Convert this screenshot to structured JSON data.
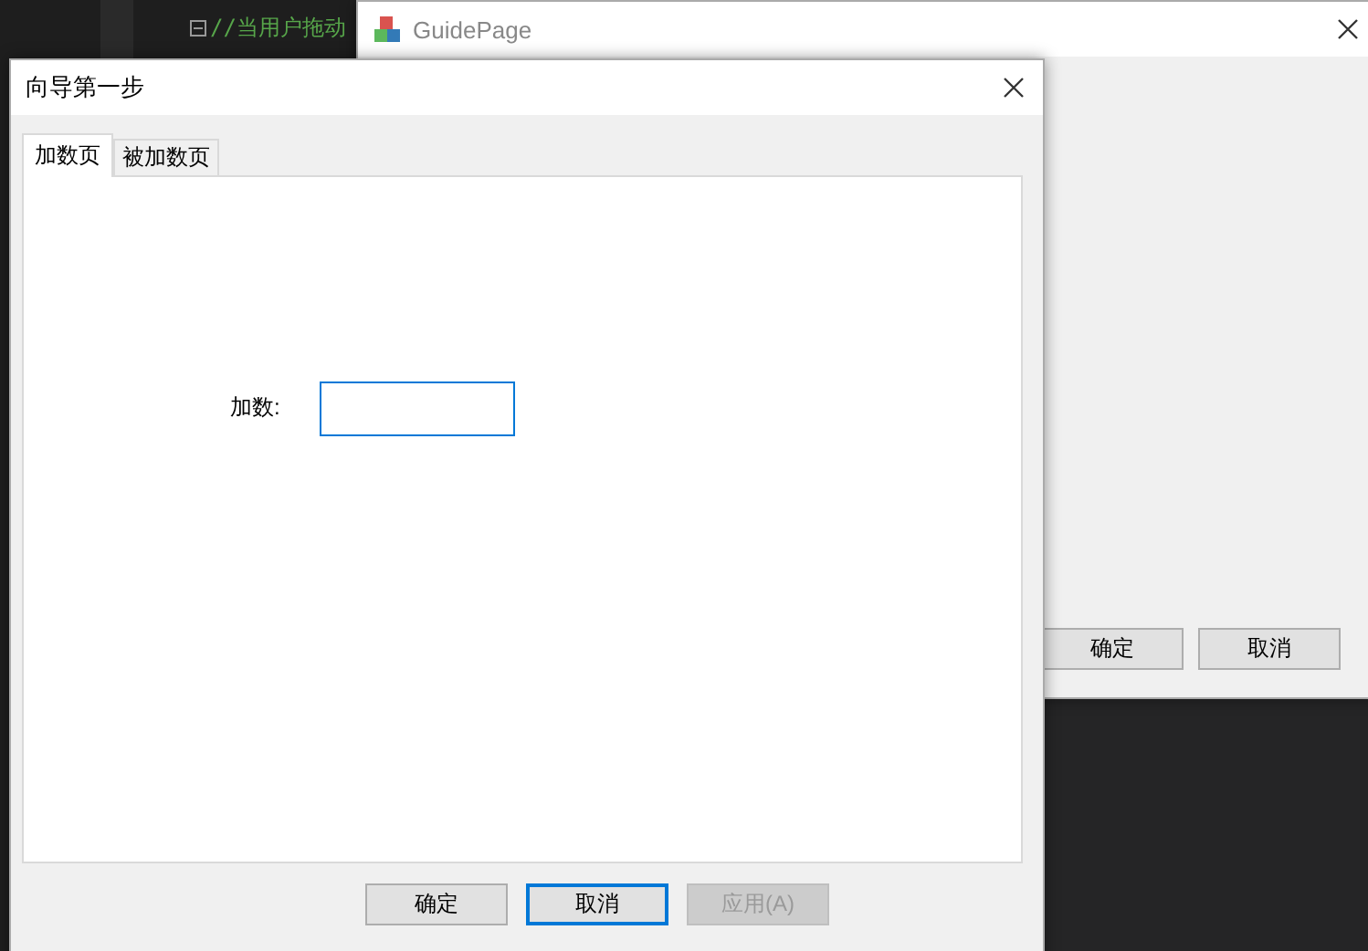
{
  "editor": {
    "lines": [
      {
        "text": "//当用户拖动"
      }
    ]
  },
  "back_window": {
    "title": "GuidePage",
    "buttons": [
      {
        "label": "确定"
      },
      {
        "label": "取消"
      }
    ]
  },
  "dialog": {
    "title": "向导第一步",
    "tabs": [
      {
        "label": "加数页",
        "selected": true
      },
      {
        "label": "被加数页",
        "selected": false
      }
    ],
    "field": {
      "label": "加数:",
      "focused": true
    },
    "buttons": [
      {
        "label": "确定",
        "default": false,
        "disabled": false
      },
      {
        "label": "取消",
        "default": true,
        "disabled": false
      },
      {
        "label": "应用(A)",
        "default": false,
        "disabled": true
      }
    ]
  }
}
